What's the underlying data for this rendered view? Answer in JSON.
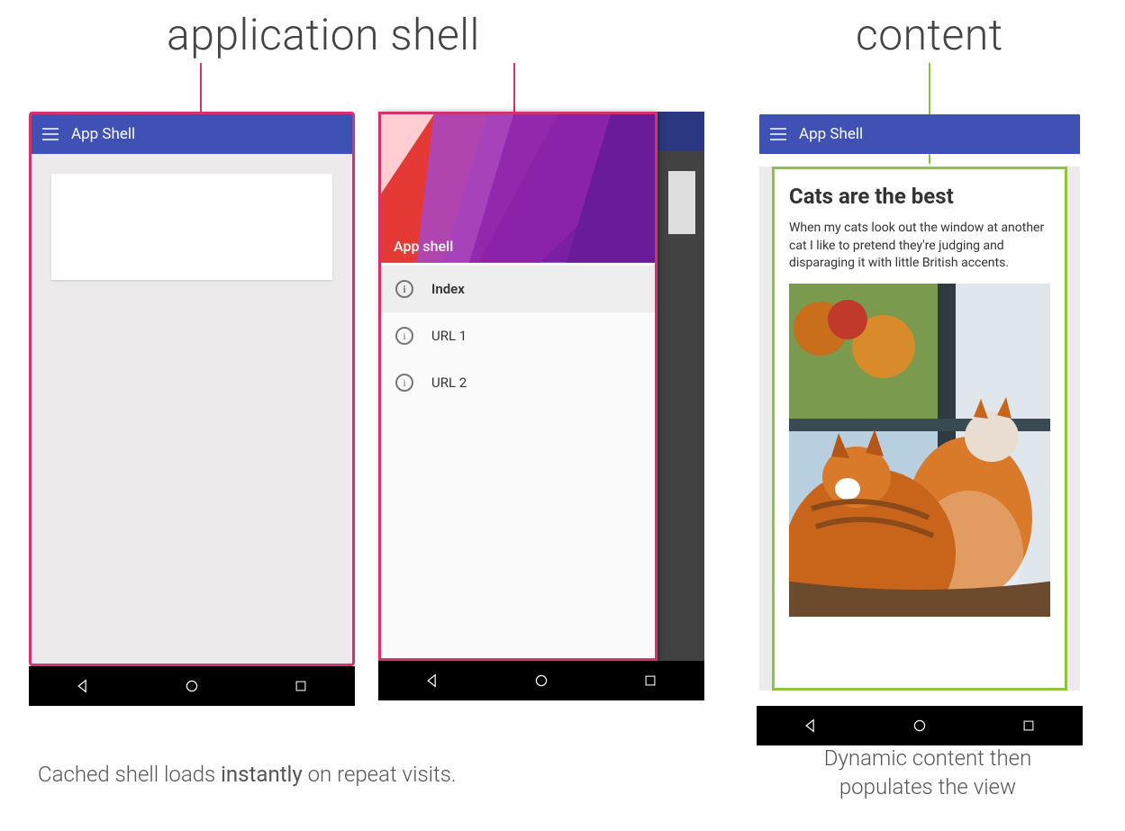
{
  "headings": {
    "app_shell": "application shell",
    "content": "content"
  },
  "captions": {
    "left_prefix": "Cached shell loads ",
    "left_bold": "instantly",
    "left_suffix": " on repeat visits.",
    "right": "Dynamic content then populates the view"
  },
  "appbar": {
    "title": "App Shell"
  },
  "drawer": {
    "hero_title": "App shell",
    "items": [
      {
        "label": "Index",
        "active": true
      },
      {
        "label": "URL 1",
        "active": false
      },
      {
        "label": "URL 2",
        "active": false
      }
    ]
  },
  "content": {
    "title": "Cats are the best",
    "body": "When my cats look out the window at another cat I like to pretend they're judging and disparaging it with little British accents."
  },
  "colors": {
    "pink": "#d6306e",
    "green": "#8cc63f",
    "indigo": "#3f51b5"
  }
}
